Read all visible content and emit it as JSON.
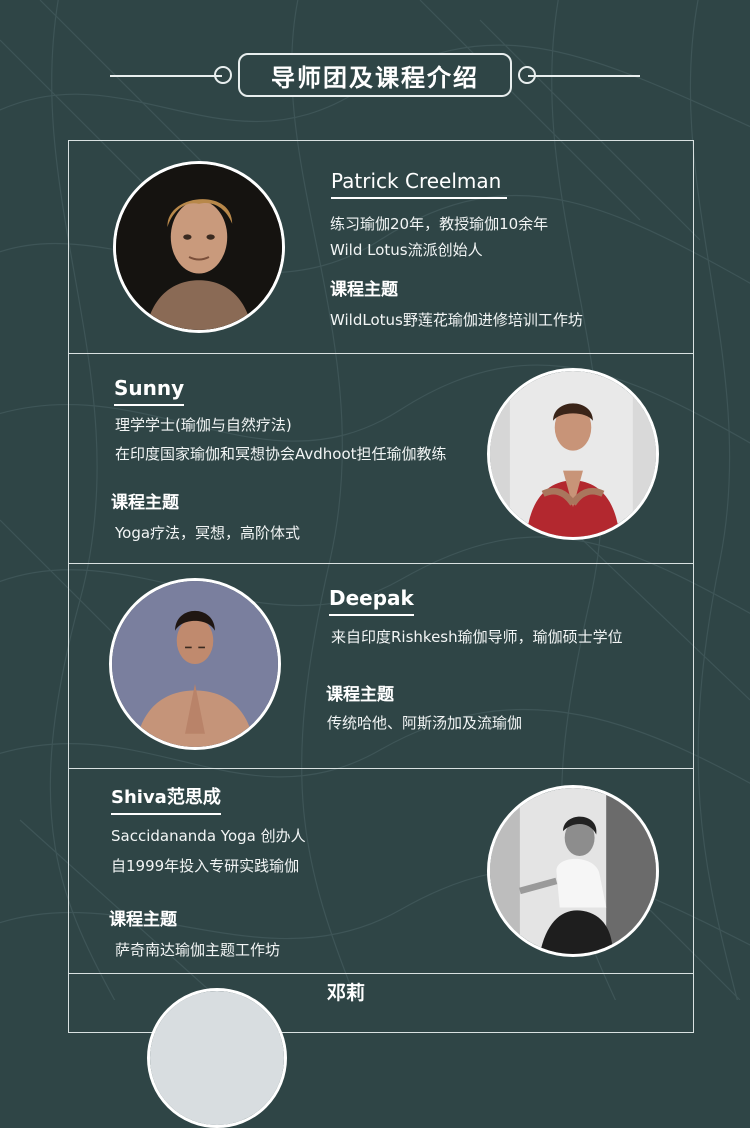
{
  "header": {
    "title": "导师团及课程介绍"
  },
  "teachers": [
    {
      "name": "Patrick Creelman",
      "lines": [
        "练习瑜伽20年，教授瑜伽10余年",
        "Wild Lotus流派创始人"
      ],
      "topic_label": "课程主题",
      "topic": "WildLotus野莲花瑜伽进修培训工作坊",
      "avatar_icon": "photo-patrick-creelman"
    },
    {
      "name": "Sunny",
      "lines": [
        "理学学士(瑜伽与自然疗法)",
        "在印度国家瑜伽和冥想协会Avdhoot担任瑜伽教练"
      ],
      "topic_label": "课程主题",
      "topic": "Yoga疗法，冥想，高阶体式",
      "avatar_icon": "photo-sunny"
    },
    {
      "name": "Deepak",
      "lines": [
        "来自印度Rishkesh瑜伽导师，瑜伽硕士学位"
      ],
      "topic_label": "课程主题",
      "topic": "传统哈他、阿斯汤加及流瑜伽",
      "avatar_icon": "photo-deepak"
    },
    {
      "name": "Shiva范思成",
      "lines": [
        "Saccidananda Yoga 创办人",
        "自1999年投入专研实践瑜伽"
      ],
      "topic_label": "课程主题",
      "topic": "萨奇南达瑜伽主题工作坊",
      "avatar_icon": "photo-shiva"
    },
    {
      "name": "邓莉",
      "avatar_icon": "photo-deng-li"
    }
  ],
  "colors": {
    "background": "#2f4546",
    "line": "#d9e1e1",
    "text": "#ffffff"
  }
}
